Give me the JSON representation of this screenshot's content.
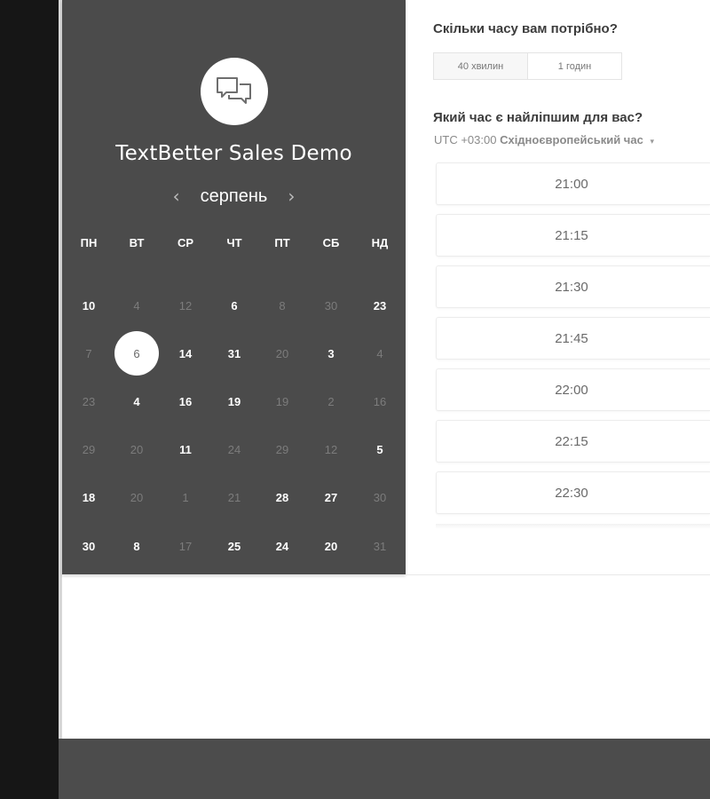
{
  "event": {
    "title": "TextBetter Sales Demo",
    "icon": "chat-bubbles-icon"
  },
  "calendar": {
    "month": "серпень",
    "prev_symbol": "‹",
    "next_symbol": "›",
    "weekdays": [
      "ПН",
      "ВТ",
      "СР",
      "ЧТ",
      "ПТ",
      "СБ",
      "НД"
    ],
    "rows": [
      [
        {
          "d": "10",
          "on": true
        },
        {
          "d": "4",
          "on": false
        },
        {
          "d": "12",
          "on": false
        },
        {
          "d": "6",
          "on": true
        },
        {
          "d": "8",
          "on": false
        },
        {
          "d": "30",
          "on": false
        },
        {
          "d": "23",
          "on": true
        }
      ],
      [
        {
          "d": "7",
          "on": false
        },
        {
          "d": "6",
          "on": true,
          "selected": true
        },
        {
          "d": "14",
          "on": true
        },
        {
          "d": "31",
          "on": true
        },
        {
          "d": "20",
          "on": false
        },
        {
          "d": "3",
          "on": true
        },
        {
          "d": "4",
          "on": false
        }
      ],
      [
        {
          "d": "23",
          "on": false
        },
        {
          "d": "4",
          "on": true
        },
        {
          "d": "16",
          "on": true
        },
        {
          "d": "19",
          "on": true
        },
        {
          "d": "19",
          "on": false
        },
        {
          "d": "2",
          "on": false
        },
        {
          "d": "16",
          "on": false
        }
      ],
      [
        {
          "d": "29",
          "on": false
        },
        {
          "d": "20",
          "on": false
        },
        {
          "d": "11",
          "on": true
        },
        {
          "d": "24",
          "on": false
        },
        {
          "d": "29",
          "on": false
        },
        {
          "d": "12",
          "on": false
        },
        {
          "d": "5",
          "on": true
        }
      ],
      [
        {
          "d": "18",
          "on": true
        },
        {
          "d": "20",
          "on": false
        },
        {
          "d": "1",
          "on": false
        },
        {
          "d": "21",
          "on": false
        },
        {
          "d": "28",
          "on": true
        },
        {
          "d": "27",
          "on": true
        },
        {
          "d": "30",
          "on": false
        }
      ],
      [
        {
          "d": "30",
          "on": true
        },
        {
          "d": "8",
          "on": true
        },
        {
          "d": "17",
          "on": false
        },
        {
          "d": "25",
          "on": true
        },
        {
          "d": "24",
          "on": true
        },
        {
          "d": "20",
          "on": true
        },
        {
          "d": "31",
          "on": false
        }
      ]
    ]
  },
  "duration": {
    "question": "Скільки часу вам потрібно?",
    "options": [
      "40 хвилин",
      "1 годин"
    ],
    "active_index": 0
  },
  "time": {
    "question": "Який час є найліпшим для вас?",
    "tz_offset": "UTC +03:00",
    "tz_name": "Східноєвропейський час",
    "tz_caret": "▾",
    "slots": [
      "21:00",
      "21:15",
      "21:30",
      "21:45",
      "22:00",
      "22:15",
      "22:30"
    ]
  },
  "colors": {
    "panel": "#4b4b4b",
    "left_strip": "#161616",
    "footer": "#4c4c4c"
  }
}
